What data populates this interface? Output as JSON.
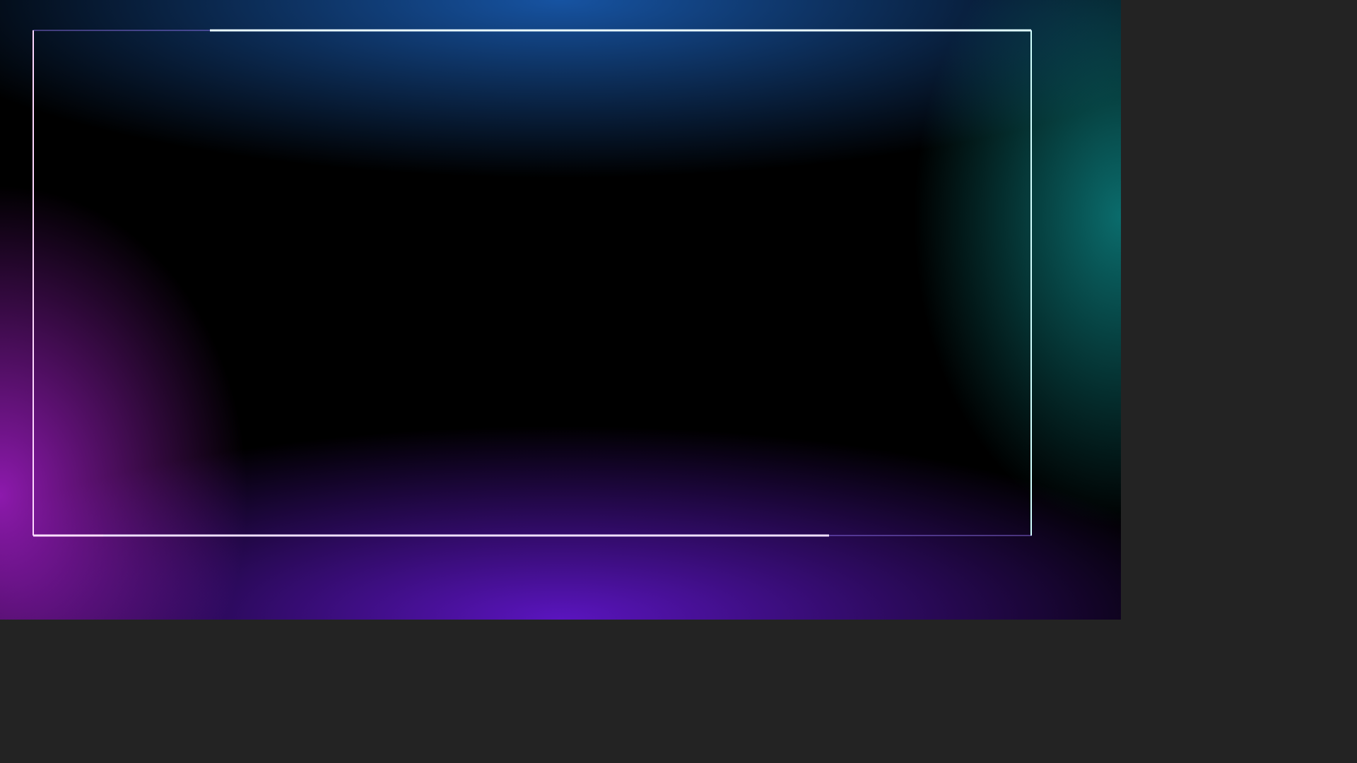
{
  "image": {
    "subject": "neon-rectangular-frame",
    "background_color": "#000000",
    "canvas_color": "#232323",
    "colors": {
      "magenta": "#e040ff",
      "blue": "#3aa0ff",
      "cyan": "#20e8e0",
      "violet": "#8a3dff",
      "white_core": "#ffffff"
    }
  }
}
